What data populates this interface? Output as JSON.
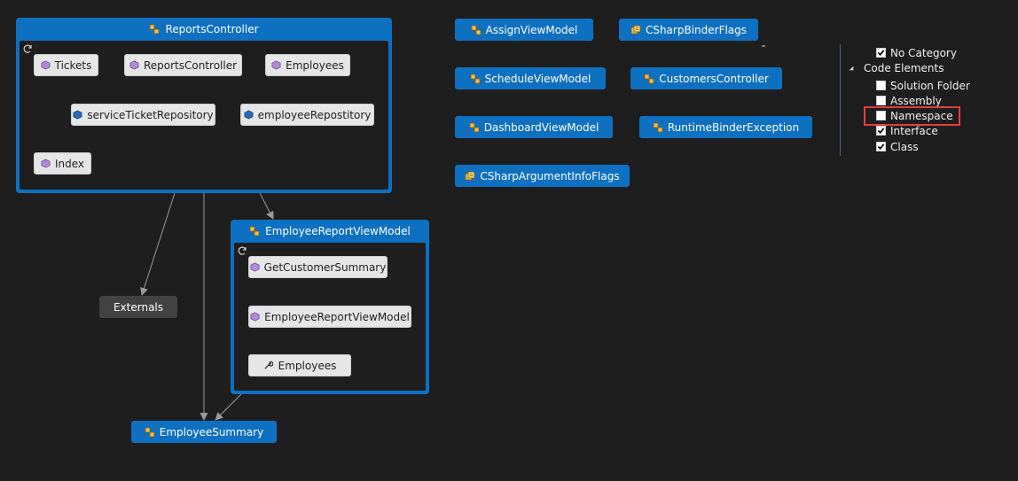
{
  "colors": {
    "background": "#1e1e1e",
    "group_blue": "#0e70c0",
    "node_light": "#e6e6e6",
    "external_node": "#424242",
    "edge_light_blue": "#8ac6f0",
    "edge_dotted": "#3c9be0",
    "edge_gray": "#9a9a9a",
    "highlight_red": "#e0403c"
  },
  "reports_controller": {
    "title": "ReportsController",
    "icon": "class-icon",
    "members": {
      "tickets": "Tickets",
      "reports_controller": "ReportsController",
      "employees": "Employees",
      "service_ticket_repository": "serviceTicketRepository",
      "employee_repository": "employeeRepostitory",
      "index": "Index"
    }
  },
  "employee_report_view_model": {
    "title": "EmployeeReportViewModel",
    "icon": "class-icon",
    "members": {
      "get_customer_summary": "GetCustomerSummary",
      "employee_report_view_model": "EmployeeReportViewModel",
      "employees": "Employees"
    }
  },
  "externals": {
    "label": "Externals"
  },
  "employee_summary": {
    "label": "EmployeeSummary"
  },
  "classes": {
    "assign_view_model": "AssignViewModel",
    "csharp_binder_flags": "CSharpBinderFlags",
    "schedule_view_model": "ScheduleViewModel",
    "customers_controller": "CustomersController",
    "dashboard_view_model": "DashboardViewModel",
    "runtime_binder_exception": "RuntimeBinderException",
    "csharp_argument_info_flags": "CSharpArgumentInfoFlags"
  },
  "legend": {
    "no_category": {
      "label": "No Category",
      "checked": true
    },
    "code_elements": {
      "label": "Code Elements",
      "expanded": true
    },
    "solution_folder": {
      "label": "Solution Folder",
      "checked": false
    },
    "assembly": {
      "label": "Assembly",
      "checked": false
    },
    "namespace": {
      "label": "Namespace",
      "checked": false
    },
    "interface": {
      "label": "Interface",
      "checked": true
    },
    "class": {
      "label": "Class",
      "checked": true
    }
  }
}
